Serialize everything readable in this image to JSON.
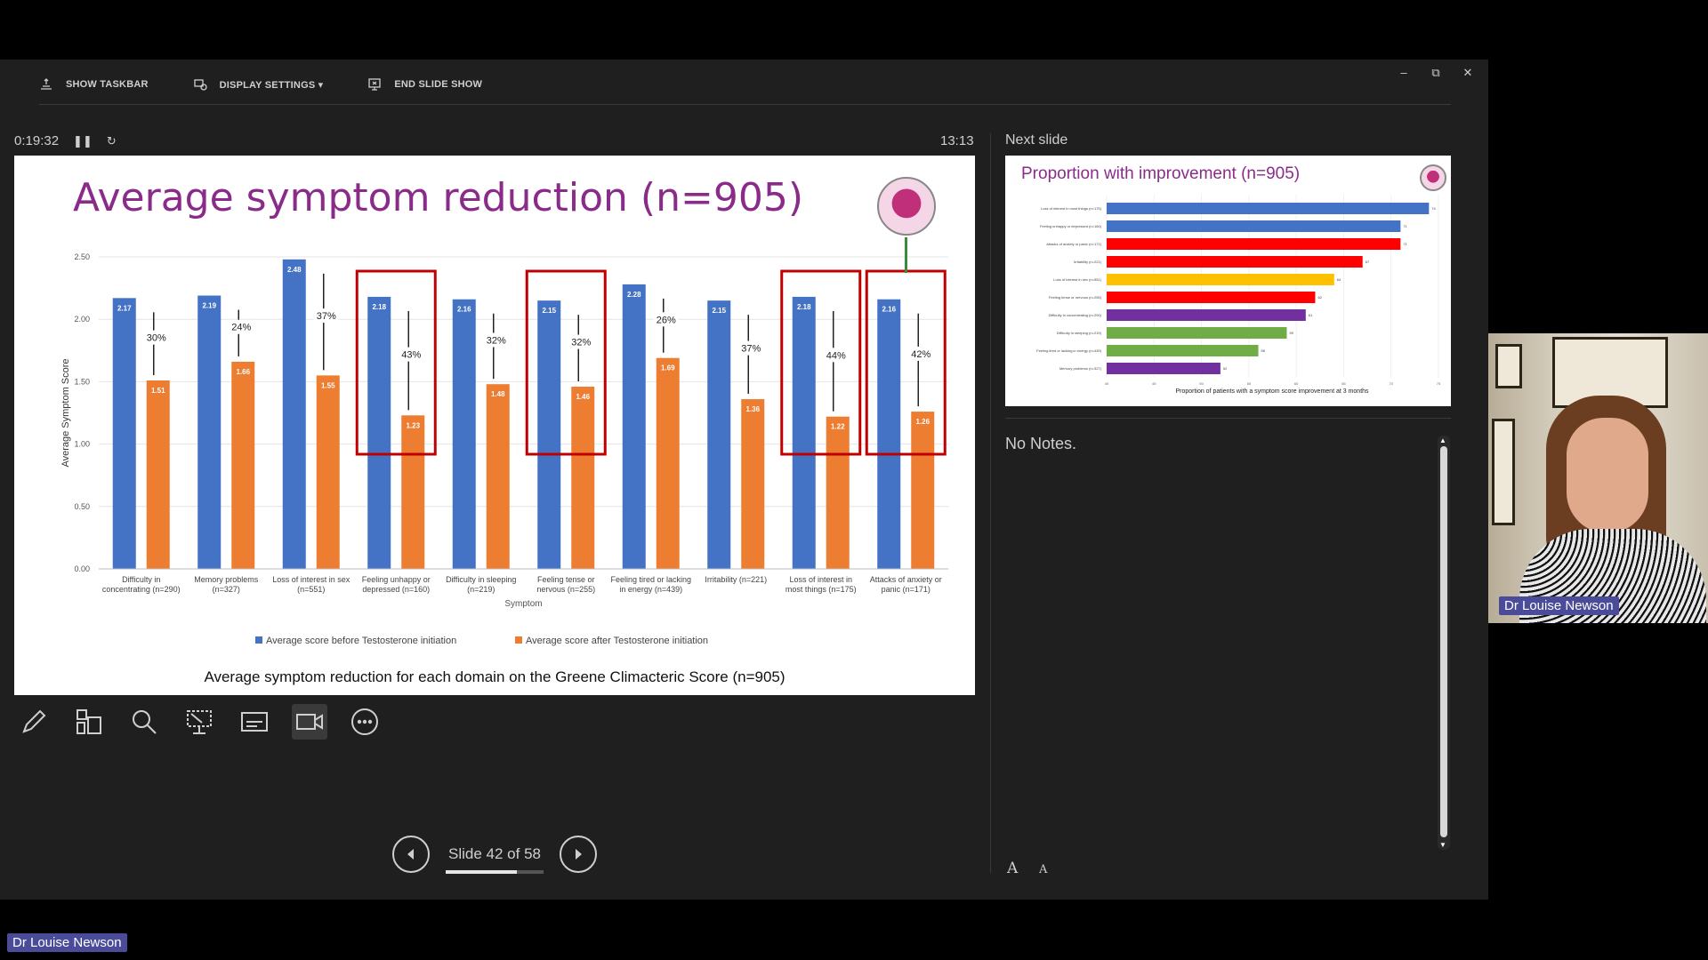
{
  "toolbar": {
    "show_taskbar": "SHOW TASKBAR",
    "display_settings": "DISPLAY SETTINGS ▾",
    "end_slide_show": "END SLIDE SHOW"
  },
  "timer": {
    "elapsed": "0:19:32",
    "clock": "13:13"
  },
  "current_slide": {
    "title": "Average symptom reduction (n=905)",
    "caption": "Average symptom reduction for each domain on the Greene Climacteric Score (n=905)"
  },
  "chart_data": {
    "type": "bar",
    "title": "",
    "xlabel": "Symptom",
    "ylabel": "Average Symptom Score",
    "ylim": [
      0,
      2.5
    ],
    "yticks": [
      "0.00",
      "0.50",
      "1.00",
      "1.50",
      "2.00",
      "2.50"
    ],
    "categories": [
      [
        "Difficulty in",
        "concentrating (n=290)"
      ],
      [
        "Memory problems",
        "(n=327)"
      ],
      [
        "Loss of interest in sex",
        "(n=551)"
      ],
      [
        "Feeling unhappy or",
        "depressed (n=160)"
      ],
      [
        "Difficulty in sleeping",
        "(n=219)"
      ],
      [
        "Feeling tense or",
        "nervous (n=255)"
      ],
      [
        "Feeling tired or lacking",
        "in energy (n=439)"
      ],
      [
        "Irritability (n=221)",
        ""
      ],
      [
        "Loss of interest in",
        "most things (n=175)"
      ],
      [
        "Attacks of anxiety or",
        "panic (n=171)"
      ]
    ],
    "series": [
      {
        "name": "Average score before Testosterone initiation",
        "color": "#4472c4",
        "values": [
          2.17,
          2.19,
          2.48,
          2.18,
          2.16,
          2.15,
          2.28,
          2.15,
          2.18,
          2.16
        ]
      },
      {
        "name": "Average score after Testosterone initiation",
        "color": "#ed7d31",
        "values": [
          1.51,
          1.66,
          1.55,
          1.23,
          1.48,
          1.46,
          1.69,
          1.36,
          1.22,
          1.26
        ]
      }
    ],
    "reductions": [
      "30%",
      "24%",
      "37%",
      "43%",
      "32%",
      "32%",
      "26%",
      "37%",
      "44%",
      "42%"
    ],
    "highlighted": [
      false,
      false,
      false,
      true,
      false,
      true,
      false,
      false,
      true,
      true
    ],
    "highlight_color": "#c00000",
    "grid": true,
    "legend": "bottom"
  },
  "next_slide": {
    "label": "Next slide",
    "title": "Proportion with improvement (n=905)",
    "chart_data": {
      "type": "bar",
      "orientation": "horizontal",
      "xlabel": "Proportion of patients with a symptom score improvement at 3 months",
      "xlim": [
        40,
        75
      ],
      "xticks": [
        "40",
        "45",
        "50",
        "55",
        "60",
        "65",
        "70",
        "75"
      ],
      "categories": [
        "Loss of interest in most things (n=175)",
        "Feeling unhappy or depressed (n=160)",
        "Attacks of anxiety or panic (n=171)",
        "Irritability (n=221)",
        "Loss of interest in sex (n=551)",
        "Feeling tense or nervous (n=255)",
        "Difficulty in concentrating (n=290)",
        "Difficulty in sleeping (n=219)",
        "Feeling tired or lacking in energy (n=439)",
        "Memory problems (n=327)"
      ],
      "values": [
        74,
        71,
        71,
        67,
        64,
        62,
        61,
        59,
        56,
        52
      ],
      "colors": [
        "#4472c4",
        "#4472c4",
        "#ff0000",
        "#ff0000",
        "#ffc000",
        "#ff0000",
        "#7030a0",
        "#70ad47",
        "#70ad47",
        "#7030a0"
      ]
    }
  },
  "notes": {
    "text": "No Notes."
  },
  "nav": {
    "slide_label": "Slide 42 of 58",
    "current": 42,
    "total": 58
  },
  "font_controls": {
    "increase": "A",
    "decrease": "A"
  },
  "participant": {
    "name": "Dr Louise Newson"
  },
  "icons": [
    "taskbar-icon",
    "display-settings-icon",
    "end-show-icon",
    "pause-icon",
    "reset-icon",
    "pen-icon",
    "see-all-slides-icon",
    "zoom-icon",
    "pointer-icon",
    "subtitles-icon",
    "camera-icon",
    "more-icon",
    "previous-icon",
    "next-icon"
  ]
}
